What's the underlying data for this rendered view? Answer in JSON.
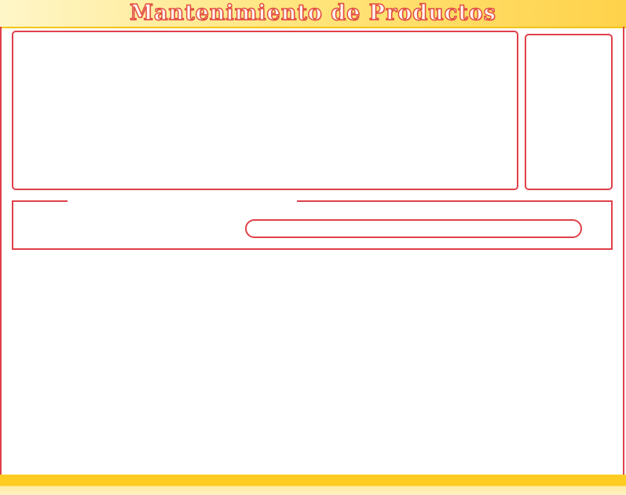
{
  "header": {
    "title": "Mantenimiento de Productos"
  },
  "colors": {
    "border": "#e0404a",
    "title_fill": "#fff4f0",
    "title_stroke": "#e24a3c",
    "bar_yellow": "#ffcc22"
  },
  "search": {
    "value": "",
    "placeholder": ""
  }
}
